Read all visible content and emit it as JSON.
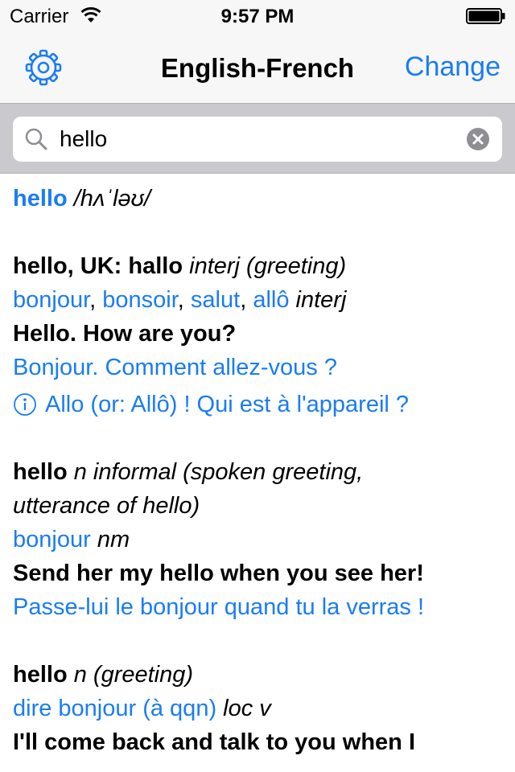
{
  "status_bar": {
    "carrier": "Carrier",
    "time": "9:57 PM"
  },
  "nav": {
    "title": "English-French",
    "change_label": "Change"
  },
  "search": {
    "value": "hello"
  },
  "colors": {
    "accent": "#1a7cf5",
    "nav_bg": "#f7f7f7",
    "search_bar_bg": "#c9c9ce"
  },
  "headword": {
    "word": "hello",
    "ipa": "/hʌˈləʊ/"
  },
  "entry1": {
    "term": "hello, UK: hallo",
    "pos": "interj (greeting)",
    "translations": [
      "bonjour",
      "bonsoir",
      "salut",
      "allô"
    ],
    "sep": ", ",
    "translations_pos": "interj",
    "example_en": "Hello. How are you?",
    "example_fr": "Bonjour. Comment allez-vous ?",
    "note": "Allo (or: Allô) ! Qui est à l'appareil ?"
  },
  "entry2": {
    "term": "hello",
    "pos_line1": "n informal (spoken greeting,",
    "pos_line2": "utterance of hello)",
    "translation": "bonjour",
    "translation_pos": "nm",
    "example_en": "Send her my hello when you see her!",
    "example_fr": "Passe-lui le bonjour quand tu la verras !"
  },
  "entry3": {
    "term": "hello",
    "pos": "n (greeting)",
    "translation": "dire bonjour (à qqn)",
    "translation_pos": "loc v",
    "example_en": "I'll come back and talk to you when I"
  }
}
